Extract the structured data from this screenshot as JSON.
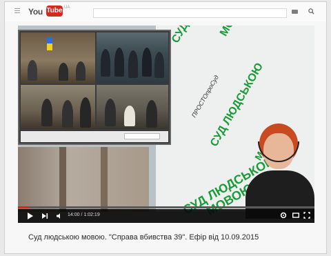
{
  "header": {
    "logo_you": "You",
    "logo_tube": "Tube",
    "logo_region": "UA",
    "search": {
      "placeholder": "",
      "value": ""
    }
  },
  "video": {
    "banner_words": [
      "СУД ЛЮДСЬКОЮ",
      "МОВОЮ",
      "СУД ЛЮДСЬКОЮ",
      "МОВОЮ",
      "СУД ЛЮДСЬКОЮ",
      "МОВОЮ",
      "ПРОСТОпроСуд"
    ],
    "time": "14:00 / 1:02:19",
    "progress": 0.04
  },
  "title": "Суд людською мовою. \"Справа вбивства 39\". Ефір від 10.09.2015",
  "colors": {
    "accent": "#e62117",
    "banner_green": "#1d9a3a",
    "logo_red": "#d42a1e"
  },
  "icons": [
    "menu-icon",
    "keyboard-icon",
    "search-icon",
    "play-icon",
    "next-icon",
    "volume-icon",
    "settings-icon",
    "theater-icon",
    "fullscreen-icon"
  ]
}
